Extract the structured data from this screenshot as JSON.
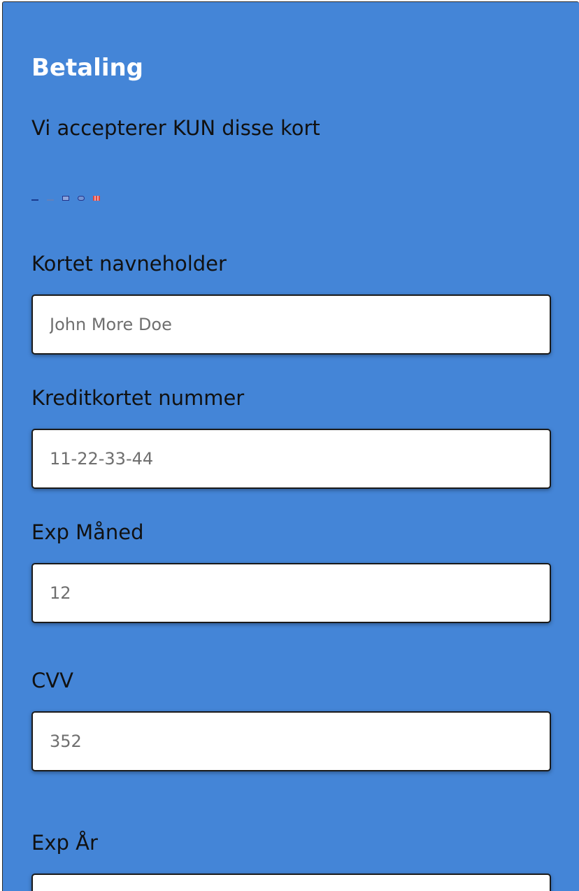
{
  "page": {
    "title": "Betaling",
    "subtitle": "Vi accepterer KUN disse kort",
    "accepted_cards": [
      {
        "name": "visa-icon"
      },
      {
        "name": "visa-electron-icon"
      },
      {
        "name": "amex-icon"
      },
      {
        "name": "diners-icon"
      },
      {
        "name": "mastercard-icon"
      }
    ],
    "background_color": "#4485d7"
  },
  "form": {
    "card_holder": {
      "label": "Kortet navneholder",
      "placeholder": "John More Doe",
      "value": ""
    },
    "card_number": {
      "label": "Kreditkortet nummer",
      "placeholder": "11-22-33-44",
      "value": ""
    },
    "exp_month": {
      "label": "Exp Måned",
      "placeholder": "12",
      "value": ""
    },
    "cvv": {
      "label": "CVV",
      "placeholder": "352",
      "value": ""
    },
    "exp_year": {
      "label": "Exp År",
      "placeholder": "",
      "value": ""
    }
  }
}
